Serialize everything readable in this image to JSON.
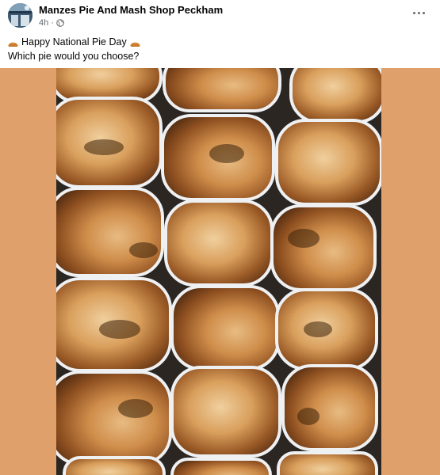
{
  "post": {
    "page_name": "Manzes Pie And Mash Shop Peckham",
    "time": "4h",
    "separator": "·",
    "privacy_icon": "globe-icon",
    "more_icon": "more-options-icon",
    "text_line1": "Happy National Pie Day",
    "text_line2": "Which pie would you choose?",
    "emoji_icon": "pie-emoji-icon"
  },
  "photo": {
    "subject": "tray-of-pies",
    "background_color": "#e0a06c"
  }
}
